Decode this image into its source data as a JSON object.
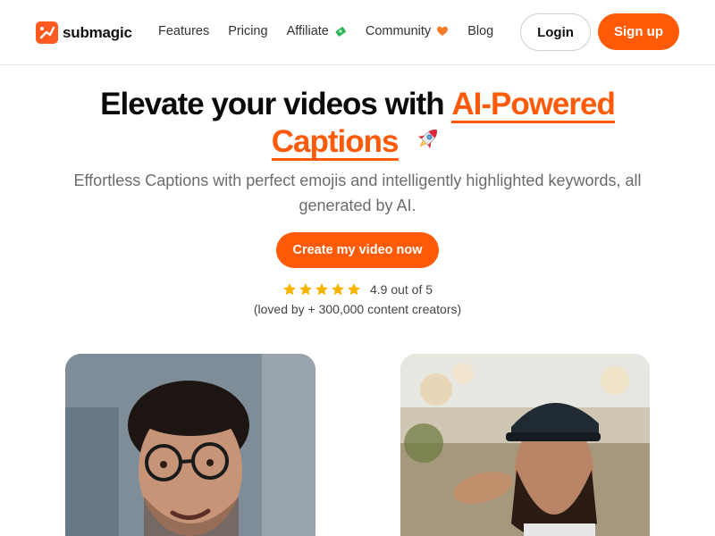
{
  "brand": {
    "name": "submagic",
    "accent": "#ff5a07"
  },
  "nav": {
    "links": [
      {
        "label": "Features"
      },
      {
        "label": "Pricing"
      },
      {
        "label": "Affiliate",
        "icon": "money-icon"
      },
      {
        "label": "Community",
        "icon": "heart-icon"
      },
      {
        "label": "Blog"
      }
    ],
    "login": "Login",
    "signup": "Sign up"
  },
  "hero": {
    "headline_part1": "Elevate your videos with ",
    "headline_accent1": "AI-Powered",
    "headline_accent2": "Captions",
    "headline_emoji": "rocket-icon",
    "subtitle": "Effortless Captions with perfect emojis and intelligently highlighted keywords, all generated by AI.",
    "cta": "Create my video now"
  },
  "rating": {
    "stars": 5,
    "score_text": "4.9 out of 5",
    "subtext": "(loved by + 300,000 content creators)"
  },
  "colors": {
    "star": "#f5b400",
    "muted_text": "#6b6b6b"
  }
}
